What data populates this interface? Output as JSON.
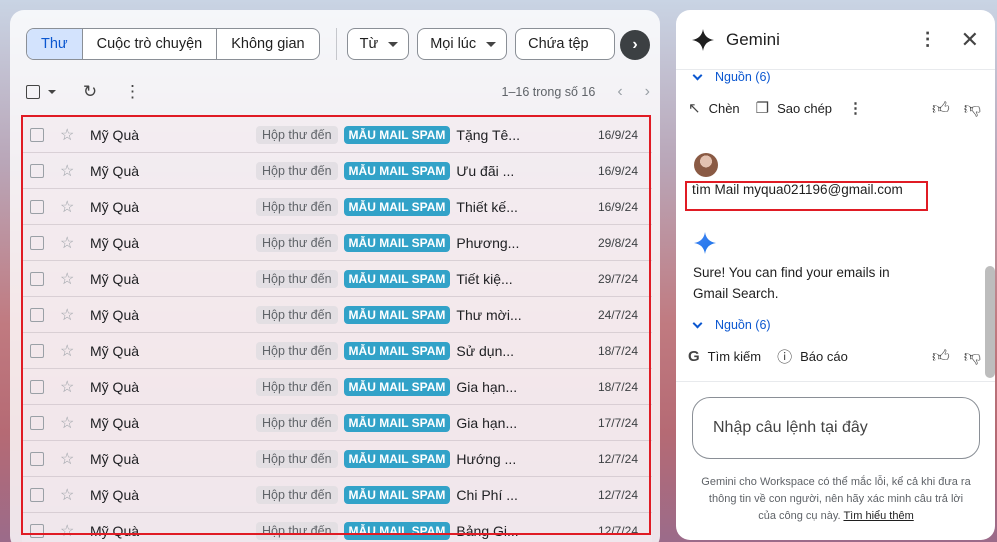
{
  "mail": {
    "filters": {
      "segments": [
        "Thư",
        "Cuộc trò chuyện",
        "Không gian"
      ],
      "chips": [
        {
          "label": "Từ"
        },
        {
          "label": "Mọi lúc"
        },
        {
          "label": "Chứa tệp"
        }
      ]
    },
    "toolbar": {
      "range": "1–16 trong số 16"
    },
    "rows": [
      {
        "sender": "Mỹ Quà",
        "inbox": "Hộp thư đến",
        "label": "MẪU MAIL SPAM",
        "subject": "Tặng Tê...",
        "date": "16/9/24"
      },
      {
        "sender": "Mỹ Quà",
        "inbox": "Hộp thư đến",
        "label": "MẪU MAIL SPAM",
        "subject": "Ưu đãi ...",
        "date": "16/9/24"
      },
      {
        "sender": "Mỹ Quà",
        "inbox": "Hộp thư đến",
        "label": "MẪU MAIL SPAM",
        "subject": "Thiết kế...",
        "date": "16/9/24"
      },
      {
        "sender": "Mỹ Quà",
        "inbox": "Hộp thư đến",
        "label": "MẪU MAIL SPAM",
        "subject": "Phương...",
        "date": "29/8/24"
      },
      {
        "sender": "Mỹ Quà",
        "inbox": "Hộp thư đến",
        "label": "MẪU MAIL SPAM",
        "subject": "Tiết kiệ...",
        "date": "29/7/24"
      },
      {
        "sender": "Mỹ Quà",
        "inbox": "Hộp thư đến",
        "label": "MẪU MAIL SPAM",
        "subject": "Thư mời...",
        "date": "24/7/24"
      },
      {
        "sender": "Mỹ Quà",
        "inbox": "Hộp thư đến",
        "label": "MẪU MAIL SPAM",
        "subject": "Sử dụn...",
        "date": "18/7/24"
      },
      {
        "sender": "Mỹ Quà",
        "inbox": "Hộp thư đến",
        "label": "MẪU MAIL SPAM",
        "subject": "Gia hạn...",
        "date": "18/7/24"
      },
      {
        "sender": "Mỹ Quà",
        "inbox": "Hộp thư đến",
        "label": "MẪU MAIL SPAM",
        "subject": "Gia hạn...",
        "date": "17/7/24"
      },
      {
        "sender": "Mỹ Quà",
        "inbox": "Hộp thư đến",
        "label": "MẪU MAIL SPAM",
        "subject": "Hướng ...",
        "date": "12/7/24"
      },
      {
        "sender": "Mỹ Quà",
        "inbox": "Hộp thư đến",
        "label": "MẪU MAIL SPAM",
        "subject": "Chi Phí ...",
        "date": "12/7/24"
      },
      {
        "sender": "Mỹ Quà",
        "inbox": "Hộp thư đến",
        "label": "MẪU MAIL SPAM",
        "subject": "Bảng Gi...",
        "date": "12/7/24"
      }
    ]
  },
  "gemini": {
    "title": "Gemini",
    "sources_1": "Nguồn (6)",
    "actions_1": {
      "insert": "Chèn",
      "copy": "Sao chép"
    },
    "user_query": "tìm Mail myqua021196@gmail.com",
    "answer": "Sure! You can find your emails in Gmail Search.",
    "sources_2": "Nguồn (6)",
    "actions_2": {
      "search": "Tìm kiếm",
      "report": "Báo cáo"
    },
    "input_placeholder": "Nhập câu lệnh tại đây",
    "disclaimer": "Gemini cho Workspace có thể mắc lỗi, kể cả khi đưa ra thông tin về con người, nên hãy xác minh câu trả lời của công cụ này.",
    "learn_more": "Tìm hiểu thêm"
  },
  "colors": {
    "accent_blue": "#0b57d0",
    "label_teal": "#32a2c8",
    "highlight_red": "#e01b24"
  }
}
